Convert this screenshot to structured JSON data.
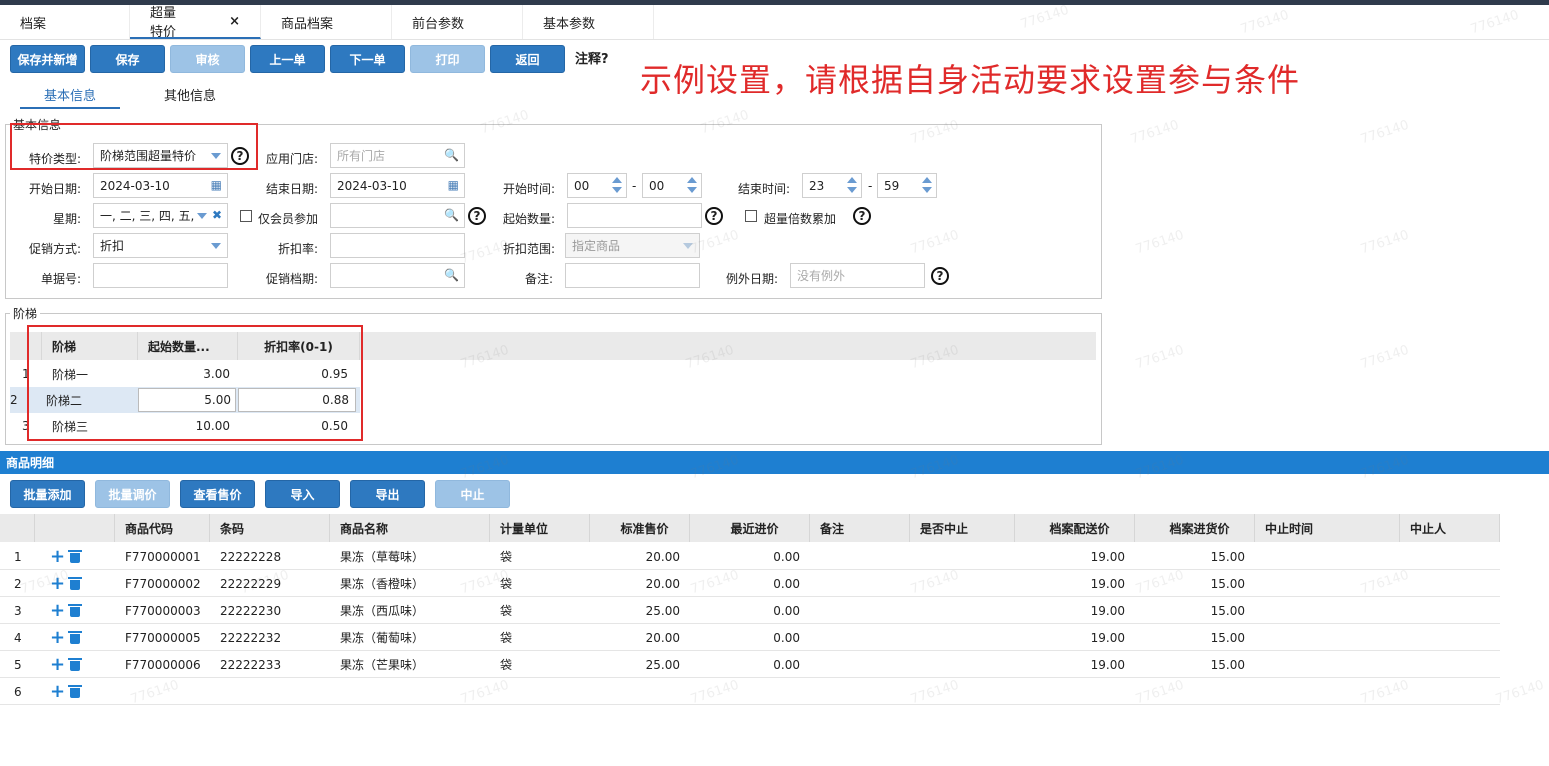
{
  "tabs": [
    {
      "label": "档案"
    },
    {
      "label": "超量特价",
      "close": "×"
    },
    {
      "label": "商品档案"
    },
    {
      "label": "前台参数"
    },
    {
      "label": "基本参数"
    }
  ],
  "toolbar": {
    "save_new": "保存并新增",
    "save": "保存",
    "audit": "审核",
    "prev": "上一单",
    "next": "下一单",
    "print": "打印",
    "back": "返回",
    "note": "注释?"
  },
  "annotation": "示例设置，请根据自身活动要求设置参与条件",
  "subtabs": {
    "basic": "基本信息",
    "other": "其他信息"
  },
  "basic": {
    "legend": "基本信息",
    "price_type_label": "特价类型:",
    "price_type_value": "阶梯范围超量特价",
    "store_label": "应用门店:",
    "store_placeholder": "所有门店",
    "start_date_label": "开始日期:",
    "start_date": "2024-03-10",
    "end_date_label": "结束日期:",
    "end_date": "2024-03-10",
    "start_time_label": "开始时间:",
    "start_hour": "00",
    "start_min": "00",
    "end_time_label": "结束时间:",
    "end_hour": "23",
    "end_min": "59",
    "weekday_label": "星期:",
    "weekday_value": "一, 二, 三, 四, 五,",
    "member_only_label": "仅会员参加",
    "start_qty_label": "起始数量:",
    "multi_acc_label": "超量倍数累加",
    "promo_label": "促销方式:",
    "promo_value": "折扣",
    "discount_label": "折扣率:",
    "range_label": "折扣范围:",
    "range_value": "指定商品",
    "doc_label": "单据号:",
    "period_label": "促销档期:",
    "remark_label": "备注:",
    "except_label": "例外日期:",
    "except_placeholder": "没有例外",
    "dash": "-",
    "help": "?"
  },
  "tier": {
    "legend": "阶梯",
    "headers": [
      "阶梯",
      "起始数量...",
      "折扣率(0-1)"
    ],
    "rows": [
      {
        "idx": "1",
        "name": "阶梯一",
        "qty": "3.00",
        "rate": "0.95"
      },
      {
        "idx": "2",
        "name": "阶梯二",
        "qty": "5.00",
        "rate": "0.88"
      },
      {
        "idx": "3",
        "name": "阶梯三",
        "qty": "10.00",
        "rate": "0.50"
      }
    ]
  },
  "goods": {
    "title": "商品明细",
    "buttons": {
      "batch_add": "批量添加",
      "batch_adjust": "批量调价",
      "view_price": "查看售价",
      "import": "导入",
      "export": "导出",
      "stop": "中止"
    },
    "headers": [
      "商品代码",
      "条码",
      "商品名称",
      "计量单位",
      "标准售价",
      "最近进价",
      "备注",
      "是否中止",
      "档案配送价",
      "档案进货价",
      "中止时间",
      "中止人"
    ],
    "rows": [
      {
        "idx": "1",
        "code": "F770000001",
        "barcode": "22222228",
        "name": "果冻（草莓味）",
        "unit": "袋",
        "std": "20.00",
        "last": "0.00",
        "dist": "19.00",
        "buy": "15.00"
      },
      {
        "idx": "2",
        "code": "F770000002",
        "barcode": "22222229",
        "name": "果冻（香橙味）",
        "unit": "袋",
        "std": "20.00",
        "last": "0.00",
        "dist": "19.00",
        "buy": "15.00"
      },
      {
        "idx": "3",
        "code": "F770000003",
        "barcode": "22222230",
        "name": "果冻（西瓜味）",
        "unit": "袋",
        "std": "25.00",
        "last": "0.00",
        "dist": "19.00",
        "buy": "15.00"
      },
      {
        "idx": "4",
        "code": "F770000005",
        "barcode": "22222232",
        "name": "果冻（葡萄味）",
        "unit": "袋",
        "std": "20.00",
        "last": "0.00",
        "dist": "19.00",
        "buy": "15.00"
      },
      {
        "idx": "5",
        "code": "F770000006",
        "barcode": "22222233",
        "name": "果冻（芒果味）",
        "unit": "袋",
        "std": "25.00",
        "last": "0.00",
        "dist": "19.00",
        "buy": "15.00"
      },
      {
        "idx": "6"
      }
    ]
  },
  "watermark": "776140",
  "colors": {
    "primary": "#2e79c0",
    "disabled": "#9dc3e6",
    "annotation": "#e02a2a",
    "bar": "#1e7fd1"
  }
}
